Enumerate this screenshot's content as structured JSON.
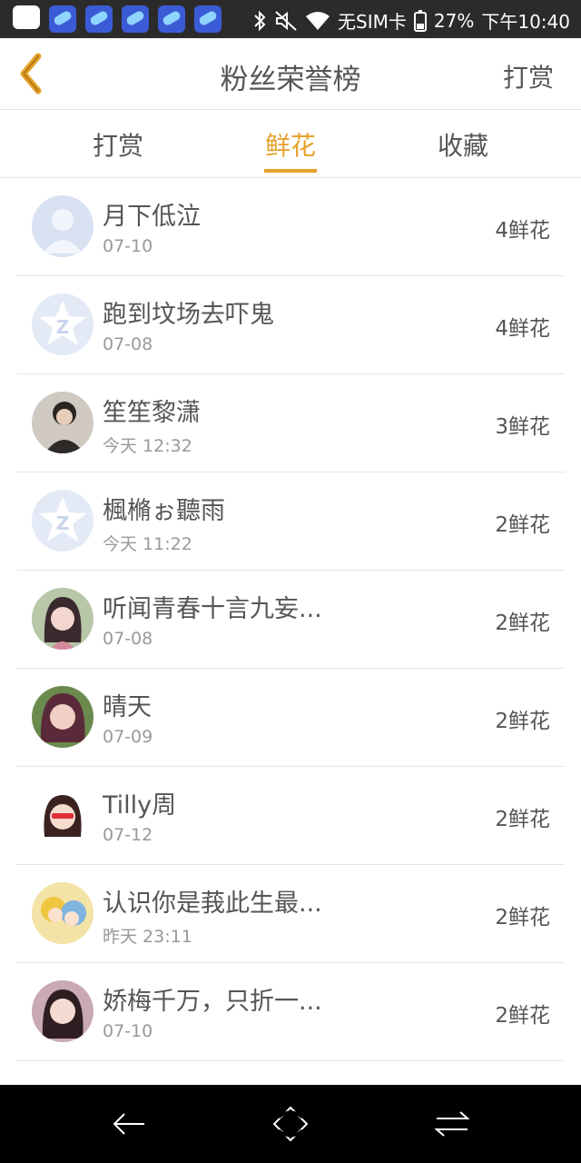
{
  "status_bar": {
    "sim": "无SIM卡",
    "battery": "27%",
    "time": "下午10:40"
  },
  "header": {
    "title": "粉丝荣誉榜",
    "action": "打赏"
  },
  "tabs": [
    {
      "label": "打赏",
      "active": false
    },
    {
      "label": "鲜花",
      "active": true
    },
    {
      "label": "收藏",
      "active": false
    }
  ],
  "accent_color": "#e6a12a",
  "fans": [
    {
      "name": "月下低泣",
      "time": "07-10",
      "count": "4鲜花",
      "avatar": "default-user-avatar"
    },
    {
      "name": "跑到坟场去吓鬼",
      "time": "07-08",
      "count": "4鲜花",
      "avatar": "qq-logo-avatar"
    },
    {
      "name": "笙笙黎潇",
      "time": "今天 12:32",
      "count": "3鲜花",
      "avatar": "photo-avatar"
    },
    {
      "name": "楓樇ぉ聽雨",
      "time": "今天 11:22",
      "count": "2鲜花",
      "avatar": "qq-logo-avatar"
    },
    {
      "name": "听闻青春十言九妄...",
      "time": "07-08",
      "count": "2鲜花",
      "avatar": "photo-avatar"
    },
    {
      "name": "晴天",
      "time": "07-09",
      "count": "2鲜花",
      "avatar": "photo-avatar"
    },
    {
      "name": "Tilly周",
      "time": "07-12",
      "count": "2鲜花",
      "avatar": "cartoon-avatar"
    },
    {
      "name": "认识你是莪此生最...",
      "time": "昨天 23:11",
      "count": "2鲜花",
      "avatar": "anime-avatar"
    },
    {
      "name": "娇梅千万，只折一...",
      "time": "07-10",
      "count": "2鲜花",
      "avatar": "photo-avatar"
    }
  ]
}
